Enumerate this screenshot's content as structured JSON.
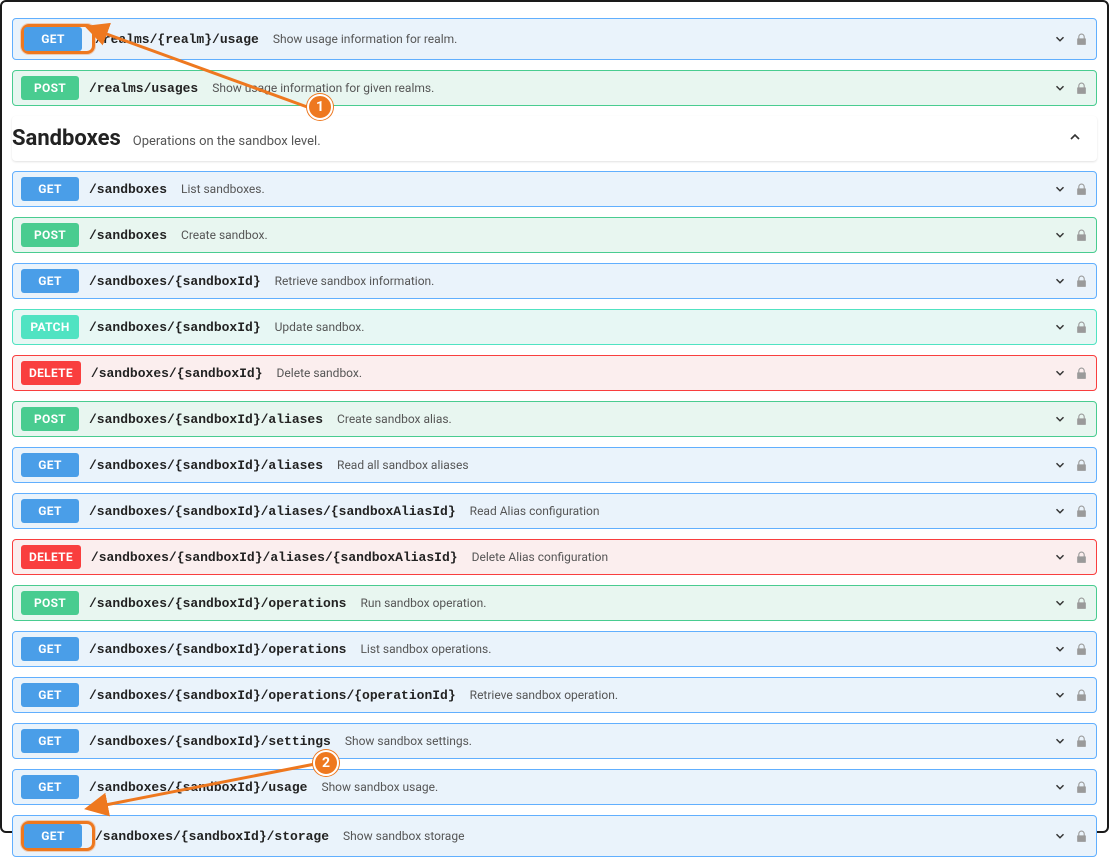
{
  "section": {
    "title": "Sandboxes",
    "desc": "Operations on the sandbox level."
  },
  "callouts": {
    "c1": "1",
    "c2": "2"
  },
  "endpoints": [
    {
      "m": "GET",
      "mc": "get",
      "path": "/realms/{realm}/usage",
      "desc": "Show usage information for realm.",
      "hl": true
    },
    {
      "m": "POST",
      "mc": "post",
      "path": "/realms/usages",
      "desc": "Show usage information for given realms."
    },
    null,
    {
      "m": "GET",
      "mc": "get",
      "path": "/sandboxes",
      "desc": "List sandboxes."
    },
    {
      "m": "POST",
      "mc": "post",
      "path": "/sandboxes",
      "desc": "Create sandbox."
    },
    {
      "m": "GET",
      "mc": "get",
      "path": "/sandboxes/{sandboxId}",
      "desc": "Retrieve sandbox information."
    },
    {
      "m": "PATCH",
      "mc": "patch",
      "path": "/sandboxes/{sandboxId}",
      "desc": "Update sandbox."
    },
    {
      "m": "DELETE",
      "mc": "delete",
      "path": "/sandboxes/{sandboxId}",
      "desc": "Delete sandbox."
    },
    {
      "m": "POST",
      "mc": "post",
      "path": "/sandboxes/{sandboxId}/aliases",
      "desc": "Create sandbox alias."
    },
    {
      "m": "GET",
      "mc": "get",
      "path": "/sandboxes/{sandboxId}/aliases",
      "desc": "Read all sandbox aliases"
    },
    {
      "m": "GET",
      "mc": "get",
      "path": "/sandboxes/{sandboxId}/aliases/{sandboxAliasId}",
      "desc": "Read Alias configuration"
    },
    {
      "m": "DELETE",
      "mc": "delete",
      "path": "/sandboxes/{sandboxId}/aliases/{sandboxAliasId}",
      "desc": "Delete Alias configuration"
    },
    {
      "m": "POST",
      "mc": "post",
      "path": "/sandboxes/{sandboxId}/operations",
      "desc": "Run sandbox operation."
    },
    {
      "m": "GET",
      "mc": "get",
      "path": "/sandboxes/{sandboxId}/operations",
      "desc": "List sandbox operations."
    },
    {
      "m": "GET",
      "mc": "get",
      "path": "/sandboxes/{sandboxId}/operations/{operationId}",
      "desc": "Retrieve sandbox operation."
    },
    {
      "m": "GET",
      "mc": "get",
      "path": "/sandboxes/{sandboxId}/settings",
      "desc": "Show sandbox settings."
    },
    {
      "m": "GET",
      "mc": "get",
      "path": "/sandboxes/{sandboxId}/usage",
      "desc": "Show sandbox usage."
    },
    {
      "m": "GET",
      "mc": "get",
      "path": "/sandboxes/{sandboxId}/storage",
      "desc": "Show sandbox storage",
      "hl": true
    }
  ]
}
